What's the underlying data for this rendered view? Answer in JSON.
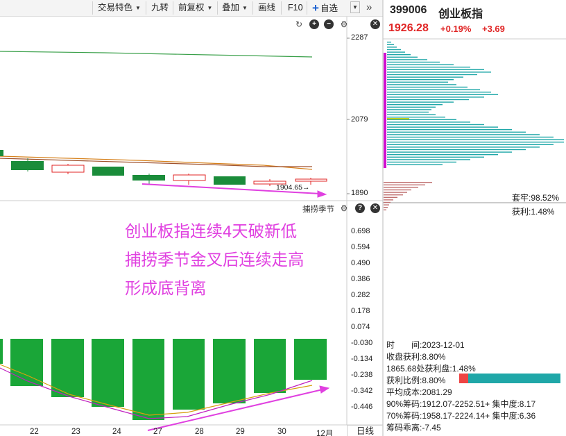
{
  "toolbar": {
    "items": [
      "交易特色",
      "九转",
      "前复权",
      "叠加",
      "画线",
      "F10",
      "自选"
    ]
  },
  "stock": {
    "code": "399006",
    "name": "创业板指",
    "price": "1926.28",
    "change_pct": "+0.19%",
    "change": "+3.69"
  },
  "price_axis": [
    "2287",
    "2079",
    "1890"
  ],
  "low_marker": "1904.65→",
  "indicator": {
    "name": "捕捞季节",
    "axis": [
      "0.698",
      "0.594",
      "0.490",
      "0.386",
      "0.282",
      "0.178",
      "0.074",
      "-0.030",
      "-0.134",
      "-0.238",
      "-0.342",
      "-0.446"
    ]
  },
  "annotation": [
    "创业板指连续4天破新低",
    "捕捞季节金叉后连续走高",
    "形成底背离"
  ],
  "dates": [
    "22",
    "23",
    "24",
    "27",
    "28",
    "29",
    "30",
    "12月"
  ],
  "period_button": "日线",
  "chips": {
    "trapped": "套牢:98.52%",
    "profit": "获利:1.48%"
  },
  "info": {
    "time": "时　　间:2023-12-01",
    "close_profit": "收盘获利:8.80%",
    "level_profit": "1865.68处获利盘:1.48%",
    "profit_ratio": "获利比例:8.80%",
    "avg_cost": "平均成本:2081.29",
    "chip90": "90%筹码:1912.07-2252.51+ 集中度:8.17",
    "chip70": "70%筹码:1958.17-2224.14+ 集中度:6.36",
    "deviation": "筹码乖离:-7.45"
  },
  "colors": {
    "up": "#e02424",
    "down": "#1a8c3a",
    "chip_teal": "#1fa7a8",
    "chip_red": "#b05050",
    "annotation": "#e040e0"
  },
  "icons": [
    "refresh-icon",
    "zoom-in-icon",
    "zoom-out-icon",
    "settings-icon",
    "close-icon",
    "help-icon",
    "chevron-down-icon",
    "expand-right-icon"
  ]
}
